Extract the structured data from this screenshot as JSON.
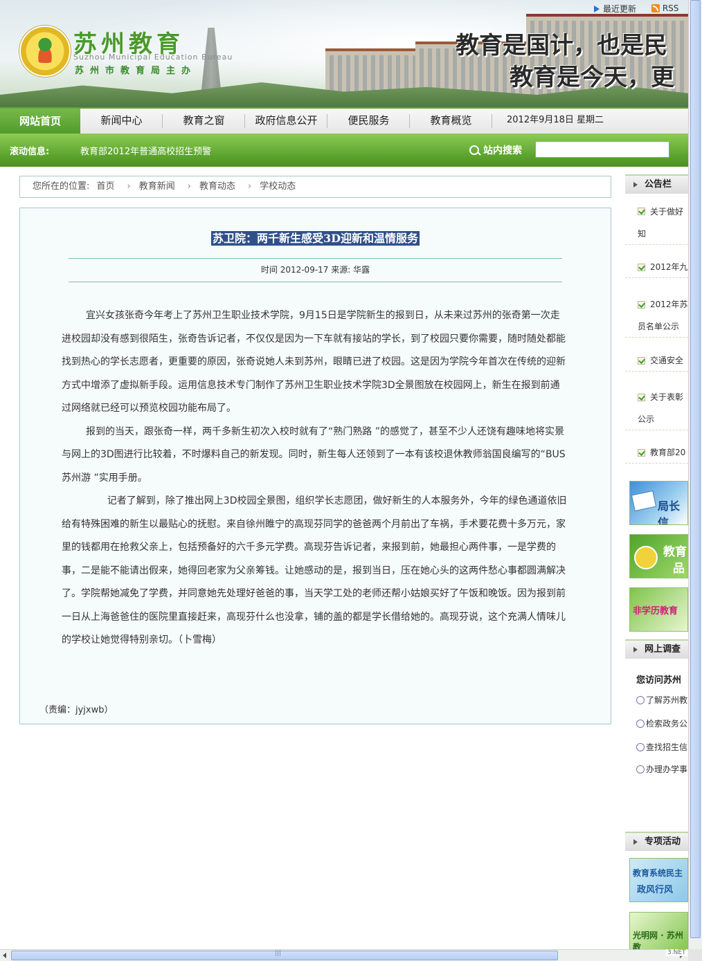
{
  "header": {
    "logo_title": "苏州教育",
    "logo_english": "Suzhou Municipal Education Bureau",
    "logo_subtitle": "苏州市教育局主办",
    "slogan_line1": "教育是国计，也是民",
    "slogan_line2": "教育是今天，更",
    "top_links": [
      "最近更新",
      "RSS"
    ]
  },
  "nav": {
    "home": "网站首页",
    "items": [
      "新闻中心",
      "教育之窗",
      "政府信息公开",
      "便民服务",
      "教育概览"
    ],
    "date": "2012年9月18日 星期二"
  },
  "ticker": {
    "label": "滚动信息:",
    "text": "教育部2012年普通高校招生预警",
    "search_label": "站内搜索",
    "search_value": ""
  },
  "breadcrumb": {
    "prefix": "您所在的位置:",
    "items": [
      "首页",
      "教育新闻",
      "教育动态",
      "学校动态"
    ]
  },
  "article": {
    "title": "苏卫院：两千新生感受3D迎新和温情服务",
    "meta": "时间 2012-09-17 来源: 华露",
    "paragraphs": [
      "宜兴女孩张奇今年考上了苏州卫生职业技术学院，9月15日是学院新生的报到日，从未来过苏州的张奇第一次走进校园却没有感到很陌生，张奇告诉记者，不仅仅是因为一下车就有接站的学长，到了校园只要你需要，随时随处都能找到热心的学长志愿者，更重要的原因，张奇说她人未到苏州，眼睛已进了校园。这是因为学院今年首次在传统的迎新方式中增添了虚拟新手段。运用信息技术专门制作了苏州卫生职业技术学院3D全景图放在校园网上，新生在报到前通过网络就已经可以预览校园功能布局了。",
      "报到的当天，跟张奇一样，两千多新生初次入校时就有了“熟门熟路 ”的感觉了，甚至不少人还饶有趣味地将实景与网上的3D图进行比较着，不时爆料自己的新发现。同时，新生每人还领到了一本有该校退休教师翁国良编写的“BUS苏州游 ”实用手册。",
      "记者了解到，除了推出网上3D校园全景图，组织学长志愿团，做好新生的人本服务外，今年的绿色通道依旧给有特殊困难的新生以最贴心的抚慰。来自徐州睢宁的高现芬同学的爸爸两个月前出了车祸，手术要花费十多万元，家里的钱都用在抢救父亲上，包括预备好的六千多元学费。高现芬告诉记者，来报到前，她最担心两件事，一是学费的事，二是能不能请出假来，她得回老家为父亲筹钱。让她感动的是，报到当日，压在她心头的这两件愁心事都圆满解决了。学院帮她减免了学费，并同意她先处理好爸爸的事，当天学工处的老师还帮小姑娘买好了午饭和晚饭。因为报到前一日从上海爸爸住的医院里直接赶来，高现芬什么也没拿，铺的盖的都是学长借给她的。高现芬说，这个充满人情味儿的学校让她觉得特别亲切。（卜雪梅）"
    ],
    "editor": "（责编：jyjxwb）"
  },
  "sidebar": {
    "notice_title": "公告栏",
    "notices": [
      {
        "line1": "关于做好",
        "line2": "知"
      },
      {
        "line1": "2012年九",
        "line2": ""
      },
      {
        "line1": "2012年苏",
        "line2": "员名单公示"
      },
      {
        "line1": "交通安全",
        "line2": ""
      },
      {
        "line1": "关于表彰",
        "line2": "公示"
      },
      {
        "line1": "教育部20",
        "line2": ""
      }
    ],
    "banners": [
      {
        "text": "局长信"
      },
      {
        "text": "教育",
        "text2": "品"
      },
      {
        "text": "非学历教育"
      }
    ],
    "survey_title": "网上调查",
    "survey_question": "您访问苏州",
    "survey_options": [
      "了解苏州教",
      "检索政务公",
      "查找招生信",
      "办理办学事"
    ],
    "special_title": "专项活动",
    "special_banners": [
      {
        "line1": "教育系统民主",
        "line2": "政风行风"
      },
      {
        "line1": "光明网 · 苏州教"
      }
    ]
  },
  "watermark": "3.NET"
}
